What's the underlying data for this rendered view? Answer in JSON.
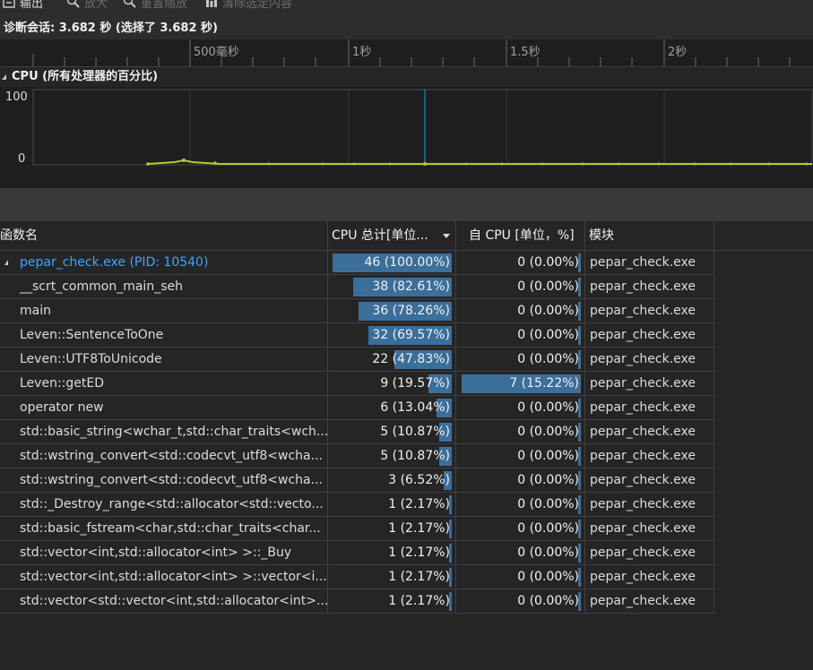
{
  "toolbar": {
    "items": [
      {
        "label": "输出",
        "icon": "output-icon"
      },
      {
        "label": "放大",
        "icon": "zoom-in-icon"
      },
      {
        "label": "重置缩放",
        "icon": "zoom-reset-icon"
      },
      {
        "label": "清除选定内容",
        "icon": "clear-selection-icon"
      }
    ]
  },
  "session": {
    "text": "诊断会话: 3.682 秒 (选择了 3.682 秒)"
  },
  "ruler": {
    "labels": [
      "500毫秒",
      "1秒",
      "1.5秒",
      "2秒"
    ]
  },
  "cpu_graph": {
    "title": "CPU (所有处理器的百分比)",
    "y_max_label": "100",
    "y_min_label": "0",
    "line_color": "#b5c92e",
    "marker_color": "#1f9fe0"
  },
  "table": {
    "columns": {
      "name": "函数名",
      "total": "CPU 总计[单位...",
      "self": "自 CPU [单位，%]",
      "module": "模块"
    },
    "rows": [
      {
        "name": "pepar_check.exe (PID: 10540)",
        "total": "46 (100.00%)",
        "total_pct": 100.0,
        "self": "0 (0.00%)",
        "self_pct": 0.0,
        "module": "pepar_check.exe"
      },
      {
        "name": "__scrt_common_main_seh",
        "total": "38 (82.61%)",
        "total_pct": 82.61,
        "self": "0 (0.00%)",
        "self_pct": 0.0,
        "module": "pepar_check.exe"
      },
      {
        "name": "main",
        "total": "36 (78.26%)",
        "total_pct": 78.26,
        "self": "0 (0.00%)",
        "self_pct": 0.0,
        "module": "pepar_check.exe"
      },
      {
        "name": "Leven::SentenceToOne",
        "total": "32 (69.57%)",
        "total_pct": 69.57,
        "self": "0 (0.00%)",
        "self_pct": 0.0,
        "module": "pepar_check.exe"
      },
      {
        "name": "Leven::UTF8ToUnicode",
        "total": "22 (47.83%)",
        "total_pct": 47.83,
        "self": "0 (0.00%)",
        "self_pct": 0.0,
        "module": "pepar_check.exe"
      },
      {
        "name": "Leven::getED",
        "total": "9 (19.57%)",
        "total_pct": 19.57,
        "self": "7 (15.22%)",
        "self_pct": 15.22,
        "module": "pepar_check.exe"
      },
      {
        "name": "operator new",
        "total": "6 (13.04%)",
        "total_pct": 13.04,
        "self": "0 (0.00%)",
        "self_pct": 0.0,
        "module": "pepar_check.exe"
      },
      {
        "name": "std::basic_string<wchar_t,std::char_traits<wch...",
        "total": "5 (10.87%)",
        "total_pct": 10.87,
        "self": "0 (0.00%)",
        "self_pct": 0.0,
        "module": "pepar_check.exe"
      },
      {
        "name": "std::wstring_convert<std::codecvt_utf8<wcha...",
        "total": "5 (10.87%)",
        "total_pct": 10.87,
        "self": "0 (0.00%)",
        "self_pct": 0.0,
        "module": "pepar_check.exe"
      },
      {
        "name": "std::wstring_convert<std::codecvt_utf8<wcha...",
        "total": "3 (6.52%)",
        "total_pct": 6.52,
        "self": "0 (0.00%)",
        "self_pct": 0.0,
        "module": "pepar_check.exe"
      },
      {
        "name": "std::_Destroy_range<std::allocator<std::vecto...",
        "total": "1 (2.17%)",
        "total_pct": 2.17,
        "self": "0 (0.00%)",
        "self_pct": 0.0,
        "module": "pepar_check.exe"
      },
      {
        "name": "std::basic_fstream<char,std::char_traits<char...",
        "total": "1 (2.17%)",
        "total_pct": 2.17,
        "self": "0 (0.00%)",
        "self_pct": 0.0,
        "module": "pepar_check.exe"
      },
      {
        "name": "std::vector<int,std::allocator<int> >::_Buy",
        "total": "1 (2.17%)",
        "total_pct": 2.17,
        "self": "0 (0.00%)",
        "self_pct": 0.0,
        "module": "pepar_check.exe"
      },
      {
        "name": "std::vector<int,std::allocator<int> >::vector<i...",
        "total": "1 (2.17%)",
        "total_pct": 2.17,
        "self": "0 (0.00%)",
        "self_pct": 0.0,
        "module": "pepar_check.exe"
      },
      {
        "name": "std::vector<std::vector<int,std::allocator<int>...",
        "total": "1 (2.17%)",
        "total_pct": 2.17,
        "self": "0 (0.00%)",
        "self_pct": 0.0,
        "module": "pepar_check.exe"
      }
    ]
  }
}
